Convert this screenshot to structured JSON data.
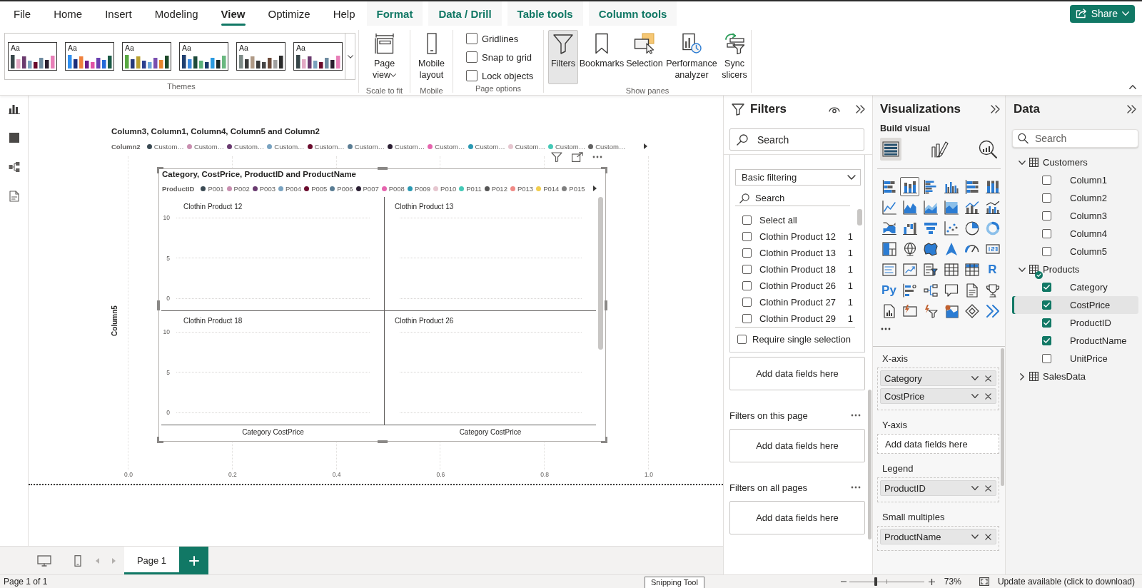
{
  "menu_tabs": [
    {
      "label": "File",
      "kind": "main",
      "selected": false
    },
    {
      "label": "Home",
      "kind": "main",
      "selected": false
    },
    {
      "label": "Insert",
      "kind": "main",
      "selected": false
    },
    {
      "label": "Modeling",
      "kind": "main",
      "selected": false
    },
    {
      "label": "View",
      "kind": "main",
      "selected": true
    },
    {
      "label": "Optimize",
      "kind": "main",
      "selected": false
    },
    {
      "label": "Help",
      "kind": "main",
      "selected": false
    },
    {
      "label": "Format",
      "kind": "contextual",
      "selected": false
    },
    {
      "label": "Data / Drill",
      "kind": "contextual",
      "selected": false
    },
    {
      "label": "Table tools",
      "kind": "contextual",
      "selected": false
    },
    {
      "label": "Column tools",
      "kind": "contextual",
      "selected": false
    }
  ],
  "share_button": {
    "label": "Share"
  },
  "ribbon": {
    "themes": {
      "group_label": "Themes",
      "items": [
        {
          "label": "Aa"
        },
        {
          "label": "Aa"
        },
        {
          "label": "Aa"
        },
        {
          "label": "Aa"
        },
        {
          "label": "Aa"
        },
        {
          "label": "Aa"
        }
      ]
    },
    "scale_to_fit": {
      "group_label": "Scale to fit",
      "button": "Page view"
    },
    "mobile": {
      "group_label": "Mobile",
      "button": "Mobile layout"
    },
    "page_options": {
      "group_label": "Page options",
      "options": [
        {
          "label": "Gridlines",
          "checked": false
        },
        {
          "label": "Snap to grid",
          "checked": false
        },
        {
          "label": "Lock objects",
          "checked": false
        }
      ]
    },
    "show_panes": {
      "group_label": "Show panes",
      "buttons": [
        {
          "label": "Filters",
          "kind": "filters",
          "selected": true
        },
        {
          "label": "Bookmarks",
          "kind": "bookmarks",
          "selected": false
        },
        {
          "label": "Selection",
          "kind": "selection",
          "selected": false
        },
        {
          "label": "Performance analyzer",
          "kind": "performance",
          "selected": false
        },
        {
          "label": "Sync slicers",
          "kind": "sync",
          "selected": false
        }
      ]
    }
  },
  "report_page": {
    "outer_visual": {
      "selected": false,
      "title": "Column3, Column1, Column4, Column5 and Column2",
      "legend": {
        "title": "Column2",
        "items": [
          {
            "label": "Custom…",
            "color": "#3b4a53"
          },
          {
            "label": "Custom…",
            "color": "#c98fb0"
          },
          {
            "label": "Custom…",
            "color": "#6a3b70"
          },
          {
            "label": "Custom…",
            "color": "#79a3c1"
          },
          {
            "label": "Custom…",
            "color": "#6b0c2e"
          },
          {
            "label": "Custom…",
            "color": "#5a7d94"
          },
          {
            "label": "Custom…",
            "color": "#2b1f33"
          },
          {
            "label": "Custom…",
            "color": "#e565ae"
          },
          {
            "label": "Custom…",
            "color": "#2a99b3"
          },
          {
            "label": "Custom…",
            "color": "#e6c6cf"
          },
          {
            "label": "Custom…",
            "color": "#45c9b7"
          },
          {
            "label": "Custom…",
            "color": "#636363"
          }
        ]
      },
      "y_axis_label": "Column5",
      "x_ticks": [
        "0.0",
        "0.2",
        "0.4",
        "0.6",
        "0.8",
        "1.0"
      ]
    },
    "small_multiples_visual": {
      "selected": true,
      "title": "Category, CostPrice, ProductID and ProductName",
      "legend": {
        "title": "ProductID",
        "items": [
          {
            "label": "P001",
            "color": "#3b4a53"
          },
          {
            "label": "P002",
            "color": "#c98fb0"
          },
          {
            "label": "P003",
            "color": "#6a3b70"
          },
          {
            "label": "P004",
            "color": "#79a3c1"
          },
          {
            "label": "P005",
            "color": "#6b0c2e"
          },
          {
            "label": "P006",
            "color": "#5a7d94"
          },
          {
            "label": "P007",
            "color": "#2b1f33"
          },
          {
            "label": "P008",
            "color": "#e565ae"
          },
          {
            "label": "P009",
            "color": "#2a99b3"
          },
          {
            "label": "P010",
            "color": "#e6c6cf"
          },
          {
            "label": "P011",
            "color": "#45c9b7"
          },
          {
            "label": "P012",
            "color": "#555555"
          },
          {
            "label": "P013",
            "color": "#f08a86"
          },
          {
            "label": "P014",
            "color": "#f2ce4e"
          },
          {
            "label": "P015",
            "color": "#7f7f7f"
          }
        ]
      },
      "panels": [
        {
          "title": "Clothin Product 12",
          "y_ticks": [
            "10",
            "5",
            "0"
          ]
        },
        {
          "title": "Clothin Product 13"
        },
        {
          "title": "Clothin Product 18",
          "y_ticks": [
            "10",
            "5",
            "0"
          ]
        },
        {
          "title": "Clothin Product 26"
        }
      ],
      "x_axis_labels": [
        "Category CostPrice",
        "Category CostPrice"
      ]
    }
  },
  "page_tabs": [
    {
      "label": "Page 1",
      "selected": true
    }
  ],
  "filters_pane": {
    "title": "Filters",
    "search_placeholder": "Search",
    "filter_card": {
      "dropdown": "Basic filtering",
      "search_placeholder": "Search",
      "items": [
        {
          "label": "Select all",
          "checked": false
        },
        {
          "label": "Clothin Product 12",
          "count": "1",
          "checked": false
        },
        {
          "label": "Clothin Product 13",
          "count": "1",
          "checked": false
        },
        {
          "label": "Clothin Product 18",
          "count": "1",
          "checked": false
        },
        {
          "label": "Clothin Product 26",
          "count": "1",
          "checked": false
        },
        {
          "label": "Clothin Product 27",
          "count": "1",
          "checked": false
        },
        {
          "label": "Clothin Product 29",
          "count": "1",
          "checked": false
        }
      ],
      "require_single_selection": {
        "label": "Require single selection",
        "checked": false
      },
      "drop_zone": "Add data fields here"
    },
    "sections": [
      {
        "title": "Filters on this page",
        "drop_zone": "Add data fields here"
      },
      {
        "title": "Filters on all pages",
        "drop_zone": "Add data fields here"
      }
    ]
  },
  "visualizations_pane": {
    "title": "Visualizations",
    "subtitle": "Build visual",
    "tabs": [
      {
        "kind": "build",
        "selected": true
      },
      {
        "kind": "format",
        "selected": false
      },
      {
        "kind": "analytics",
        "selected": false
      }
    ],
    "gallery": [
      {
        "kind": "stackedbar",
        "selected": false
      },
      {
        "kind": "stackedcolumn",
        "selected": true
      },
      {
        "kind": "clusteredbar",
        "selected": false
      },
      {
        "kind": "clusteredcolumn",
        "selected": false
      },
      {
        "kind": "fullbar",
        "selected": false
      },
      {
        "kind": "fullcolumn",
        "selected": false
      },
      {
        "kind": "line",
        "selected": false
      },
      {
        "kind": "area",
        "selected": false
      },
      {
        "kind": "stackedarea",
        "selected": false
      },
      {
        "kind": "fullarea",
        "selected": false
      },
      {
        "kind": "linecolumn",
        "selected": false
      },
      {
        "kind": "lineclustered",
        "selected": false
      },
      {
        "kind": "ribbon",
        "selected": false
      },
      {
        "kind": "waterfall",
        "selected": false
      },
      {
        "kind": "funnel",
        "selected": false
      },
      {
        "kind": "scatter",
        "selected": false
      },
      {
        "kind": "pie",
        "selected": false
      },
      {
        "kind": "donut",
        "selected": false
      },
      {
        "kind": "treemap",
        "selected": false
      },
      {
        "kind": "globe",
        "selected": false
      },
      {
        "kind": "filledmap",
        "selected": false
      },
      {
        "kind": "azuremap",
        "selected": false
      },
      {
        "kind": "gauge",
        "selected": false
      },
      {
        "kind": "card",
        "selected": false
      },
      {
        "kind": "multicard",
        "selected": false
      },
      {
        "kind": "kpi",
        "selected": false
      },
      {
        "kind": "slicer",
        "selected": false
      },
      {
        "kind": "table",
        "selected": false
      },
      {
        "kind": "matrix",
        "selected": false
      },
      {
        "kind": "script",
        "label": "R",
        "selected": false
      },
      {
        "kind": "script",
        "label": "Py",
        "selected": false
      },
      {
        "kind": "influencers",
        "selected": false
      },
      {
        "kind": "decomposition",
        "selected": false
      },
      {
        "kind": "qna",
        "selected": false
      },
      {
        "kind": "narrative",
        "selected": false
      },
      {
        "kind": "goals",
        "selected": false
      },
      {
        "kind": "paginated",
        "selected": false
      },
      {
        "kind": "powerapps",
        "selected": false
      },
      {
        "kind": "automate",
        "selected": false
      },
      {
        "kind": "arcgis",
        "selected": false
      },
      {
        "kind": "diamond",
        "selected": false
      },
      {
        "kind": "chevrons",
        "selected": false
      }
    ],
    "wells": [
      {
        "label": "X-axis",
        "fields": [
          "Category",
          "CostPrice"
        ]
      },
      {
        "label": "Y-axis",
        "placeholder": "Add data fields here"
      },
      {
        "label": "Legend",
        "fields": [
          "ProductID"
        ]
      },
      {
        "label": "Small multiples",
        "fields": [
          "ProductName"
        ]
      }
    ]
  },
  "data_pane": {
    "title": "Data",
    "search_placeholder": "Search",
    "tables": [
      {
        "label": "Customers",
        "expanded": true,
        "in_use": false,
        "children": [
          {
            "label": "Column1",
            "checked": false,
            "selected": false
          },
          {
            "label": "Column2",
            "checked": false,
            "selected": false
          },
          {
            "label": "Column3",
            "checked": false,
            "selected": false
          },
          {
            "label": "Column4",
            "checked": false,
            "selected": false
          },
          {
            "label": "Column5",
            "checked": false,
            "selected": false
          }
        ]
      },
      {
        "label": "Products",
        "expanded": true,
        "in_use": true,
        "children": [
          {
            "label": "Category",
            "checked": true,
            "selected": false
          },
          {
            "label": "CostPrice",
            "checked": true,
            "selected": true
          },
          {
            "label": "ProductID",
            "checked": true,
            "selected": false
          },
          {
            "label": "ProductName",
            "checked": true,
            "selected": false
          },
          {
            "label": "UnitPrice",
            "checked": false,
            "selected": false
          }
        ]
      },
      {
        "label": "SalesData",
        "expanded": false,
        "in_use": false
      }
    ]
  },
  "status_bar": {
    "page_info": "Page 1 of 1",
    "tooltip": "Snipping Tool",
    "zoom": {
      "level": 0.35,
      "reading": "73%"
    },
    "update_link": "Update available (click to download)"
  }
}
